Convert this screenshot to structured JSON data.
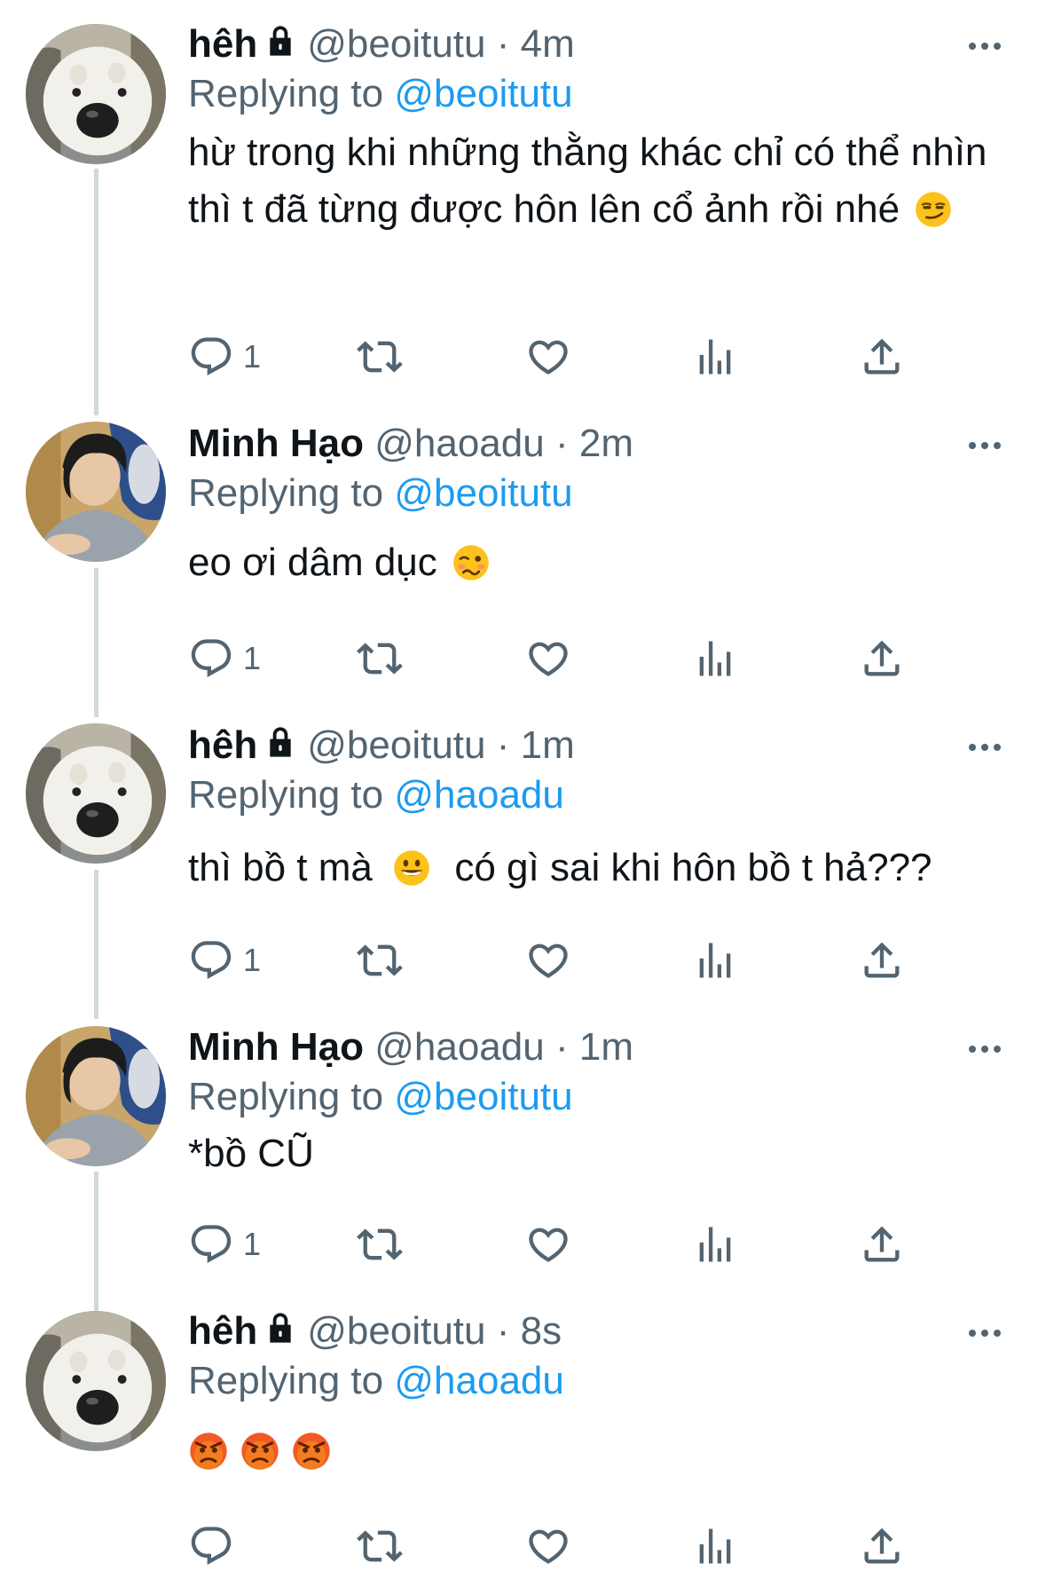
{
  "tweets": [
    {
      "name": "hêh",
      "locked": true,
      "handle": "@beoitutu",
      "time": "4m",
      "reply_prefix": "Replying to",
      "reply_to": "@beoitutu",
      "text": "hừ trong khi những thằng khác chỉ có thể nhìn thì t đã từng được hôn lên cổ ảnh rồi nhé",
      "reply_count": "1"
    },
    {
      "name": "Minh Hạo",
      "locked": false,
      "handle": "@haoadu",
      "time": "2m",
      "reply_prefix": "Replying to",
      "reply_to": "@beoitutu",
      "text": "eo ơi dâm dục",
      "reply_count": "1"
    },
    {
      "name": "hêh",
      "locked": true,
      "handle": "@beoitutu",
      "time": "1m",
      "reply_prefix": "Replying to",
      "reply_to": "@haoadu",
      "text_before": "thì bồ t mà",
      "text_after": "có gì sai khi hôn bồ t hả???",
      "reply_count": "1"
    },
    {
      "name": "Minh Hạo",
      "locked": false,
      "handle": "@haoadu",
      "time": "1m",
      "reply_prefix": "Replying to",
      "reply_to": "@beoitutu",
      "text": "*bồ CŨ",
      "reply_count": "1"
    },
    {
      "name": "hêh",
      "locked": true,
      "handle": "@beoitutu",
      "time": "8s",
      "reply_prefix": "Replying to",
      "reply_to": "@haoadu",
      "text": "",
      "reply_count": ""
    }
  ],
  "separator": "·",
  "icons": {
    "reply": "reply-icon",
    "retweet": "retweet-icon",
    "like": "like-icon",
    "views": "views-icon",
    "share": "share-icon",
    "more": "more-icon"
  },
  "colors": {
    "mention": "#1d9bf0",
    "secondary": "#536471",
    "icon": "#536471"
  }
}
